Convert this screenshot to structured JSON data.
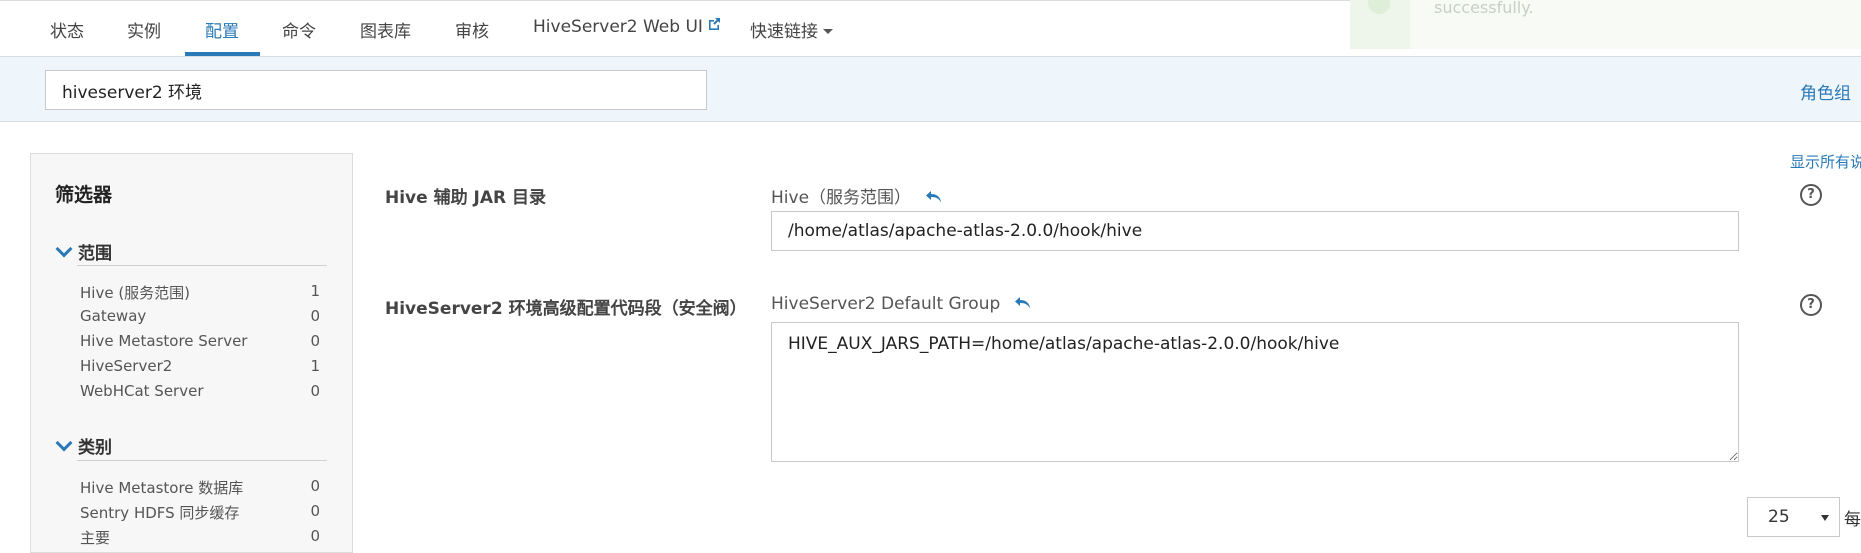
{
  "tabs": [
    {
      "label": "状态"
    },
    {
      "label": "实例"
    },
    {
      "label": "配置"
    },
    {
      "label": "命令"
    },
    {
      "label": "图表库"
    },
    {
      "label": "审核"
    },
    {
      "label": "HiveServer2 Web UI"
    },
    {
      "label": "快速链接"
    }
  ],
  "active_tab": "配置",
  "toast": {
    "message": "successfully."
  },
  "search": {
    "value": "hiveserver2 环境"
  },
  "role_group_link": "角色组",
  "show_all_link": "显示所有说",
  "filter": {
    "title": "筛选器",
    "sections": [
      {
        "title": "范围",
        "items": [
          {
            "label": "Hive (服务范围)",
            "count": "1"
          },
          {
            "label": "Gateway",
            "count": "0"
          },
          {
            "label": "Hive Metastore Server",
            "count": "0"
          },
          {
            "label": "HiveServer2",
            "count": "1"
          },
          {
            "label": "WebHCat Server",
            "count": "0"
          }
        ]
      },
      {
        "title": "类别",
        "items": [
          {
            "label": "Hive Metastore 数据库",
            "count": "0"
          },
          {
            "label": "Sentry HDFS 同步缓存",
            "count": "0"
          },
          {
            "label": "主要",
            "count": "0"
          }
        ]
      }
    ]
  },
  "properties": [
    {
      "label": "Hive 辅助 JAR 目录",
      "scope": "Hive（服务范围）",
      "value": "/home/atlas/apache-atlas-2.0.0/hook/hive"
    },
    {
      "label": "HiveServer2 环境高级配置代码段（安全阀）",
      "scope": "HiveServer2 Default Group",
      "value": "HIVE_AUX_JARS_PATH=/home/atlas/apache-atlas-2.0.0/hook/hive"
    }
  ],
  "help_glyph": "?",
  "pager": {
    "per_page": "25",
    "suffix": "每"
  },
  "colors": {
    "accent": "#2a7ab8",
    "band": "#eef5fb",
    "filter_bg": "#f7f7f7"
  }
}
